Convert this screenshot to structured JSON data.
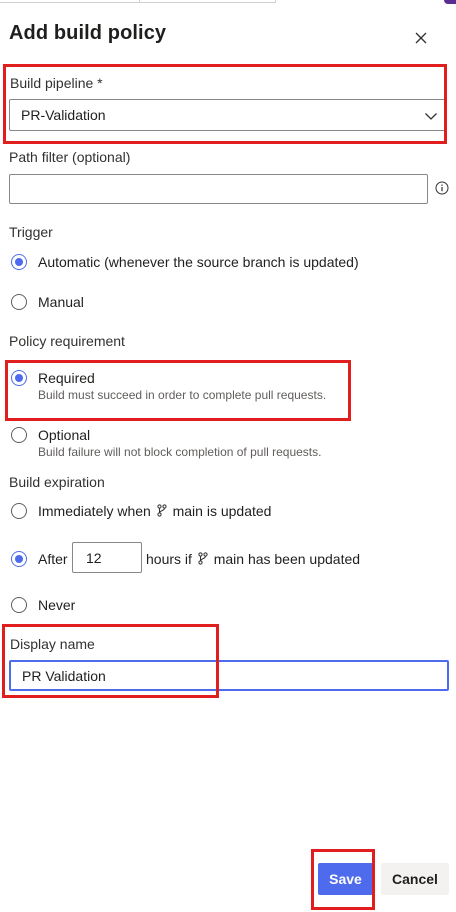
{
  "dialog": {
    "title": "Add build policy"
  },
  "build_pipeline": {
    "label": "Build pipeline *",
    "value": "PR-Validation"
  },
  "path_filter": {
    "label": "Path filter (optional)",
    "value": ""
  },
  "trigger": {
    "label": "Trigger",
    "options": [
      {
        "label": "Automatic (whenever the source branch is updated)",
        "checked": true
      },
      {
        "label": "Manual",
        "checked": false
      }
    ]
  },
  "policy_requirement": {
    "label": "Policy requirement",
    "options": [
      {
        "label": "Required",
        "description": "Build must succeed in order to complete pull requests.",
        "checked": true
      },
      {
        "label": "Optional",
        "description": "Build failure will not block completion of pull requests.",
        "checked": false
      }
    ]
  },
  "build_expiration": {
    "label": "Build expiration",
    "immediately_prefix": "Immediately when",
    "immediately_suffix": "main is updated",
    "after_prefix": "After",
    "after_hours": "12",
    "after_suffix_a": "hours if",
    "after_suffix_b": "main has been updated",
    "never_label": "Never",
    "selected": "after"
  },
  "display_name": {
    "label": "Display name",
    "value": "PR Validation"
  },
  "actions": {
    "save_label": "Save",
    "cancel_label": "Cancel"
  },
  "colors": {
    "accent": "#4f6bed",
    "highlight": "#e01e1e"
  }
}
